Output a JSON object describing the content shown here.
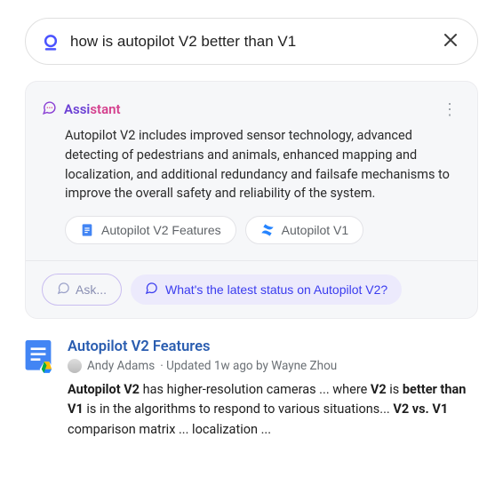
{
  "search": {
    "query": "how is autopilot V2 better than V1"
  },
  "assistant": {
    "label_part1": "Assi",
    "label_part2": "stant",
    "body": "Autopilot V2 includes improved sensor technology, advanced detecting of pedestrians and animals, enhanced mapping and localization, and additional redundancy and failsafe mechanisms to improve the overall safety and reliability of the system.",
    "sources": [
      {
        "label": "Autopilot V2 Features",
        "icon": "gdoc"
      },
      {
        "label": "Autopilot V1",
        "icon": "confluence"
      }
    ],
    "ask_label": "Ask...",
    "suggestion": "What's the latest status on Autopilot V2?"
  },
  "result": {
    "title": "Autopilot V2 Features",
    "author": "Andy Adams",
    "meta_rest": "· Updated 1w ago by Wayne Zhou",
    "snippet_parts": {
      "b1": "Autopilot V2",
      "t1": " has higher-resolution cameras ... where ",
      "b2": "V2",
      "t2": " is ",
      "b3": "better than V1",
      "t3": " is in the algorithms to respond to various situations... ",
      "b4": "V2 vs. V1",
      "t4": " comparison matrix ... localization ..."
    }
  }
}
